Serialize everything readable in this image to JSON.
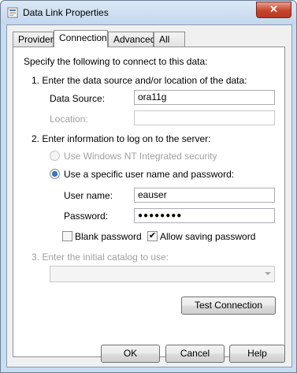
{
  "window": {
    "title": "Data Link Properties",
    "close_label": "✕",
    "icon": "data-link-icon"
  },
  "tabs": [
    {
      "label": "Provider",
      "active": false
    },
    {
      "label": "Connection",
      "active": true
    },
    {
      "label": "Advanced",
      "active": false
    },
    {
      "label": "All",
      "active": false
    }
  ],
  "connection": {
    "intro": "Specify the following to connect to this data:",
    "step1": "1. Enter the data source and/or location of the data:",
    "data_source_label": "Data Source:",
    "data_source_value": "ora11g",
    "location_label": "Location:",
    "location_value": "",
    "step2": "2. Enter information to log on to the server:",
    "nt_security_label": "Use Windows NT Integrated security",
    "specific_user_label": "Use a specific user name and password:",
    "user_name_label": "User name:",
    "user_name_value": "eauser",
    "password_label": "Password:",
    "password_value": "●●●●●●●●",
    "blank_password_label": "Blank password",
    "blank_password_checked": false,
    "allow_saving_label": "Allow saving password",
    "allow_saving_checked": true,
    "step3": "3. Enter the initial catalog to use:",
    "catalog_value": "",
    "test_connection_label": "Test Connection"
  },
  "footer": {
    "ok_label": "OK",
    "cancel_label": "Cancel",
    "help_label": "Help"
  }
}
